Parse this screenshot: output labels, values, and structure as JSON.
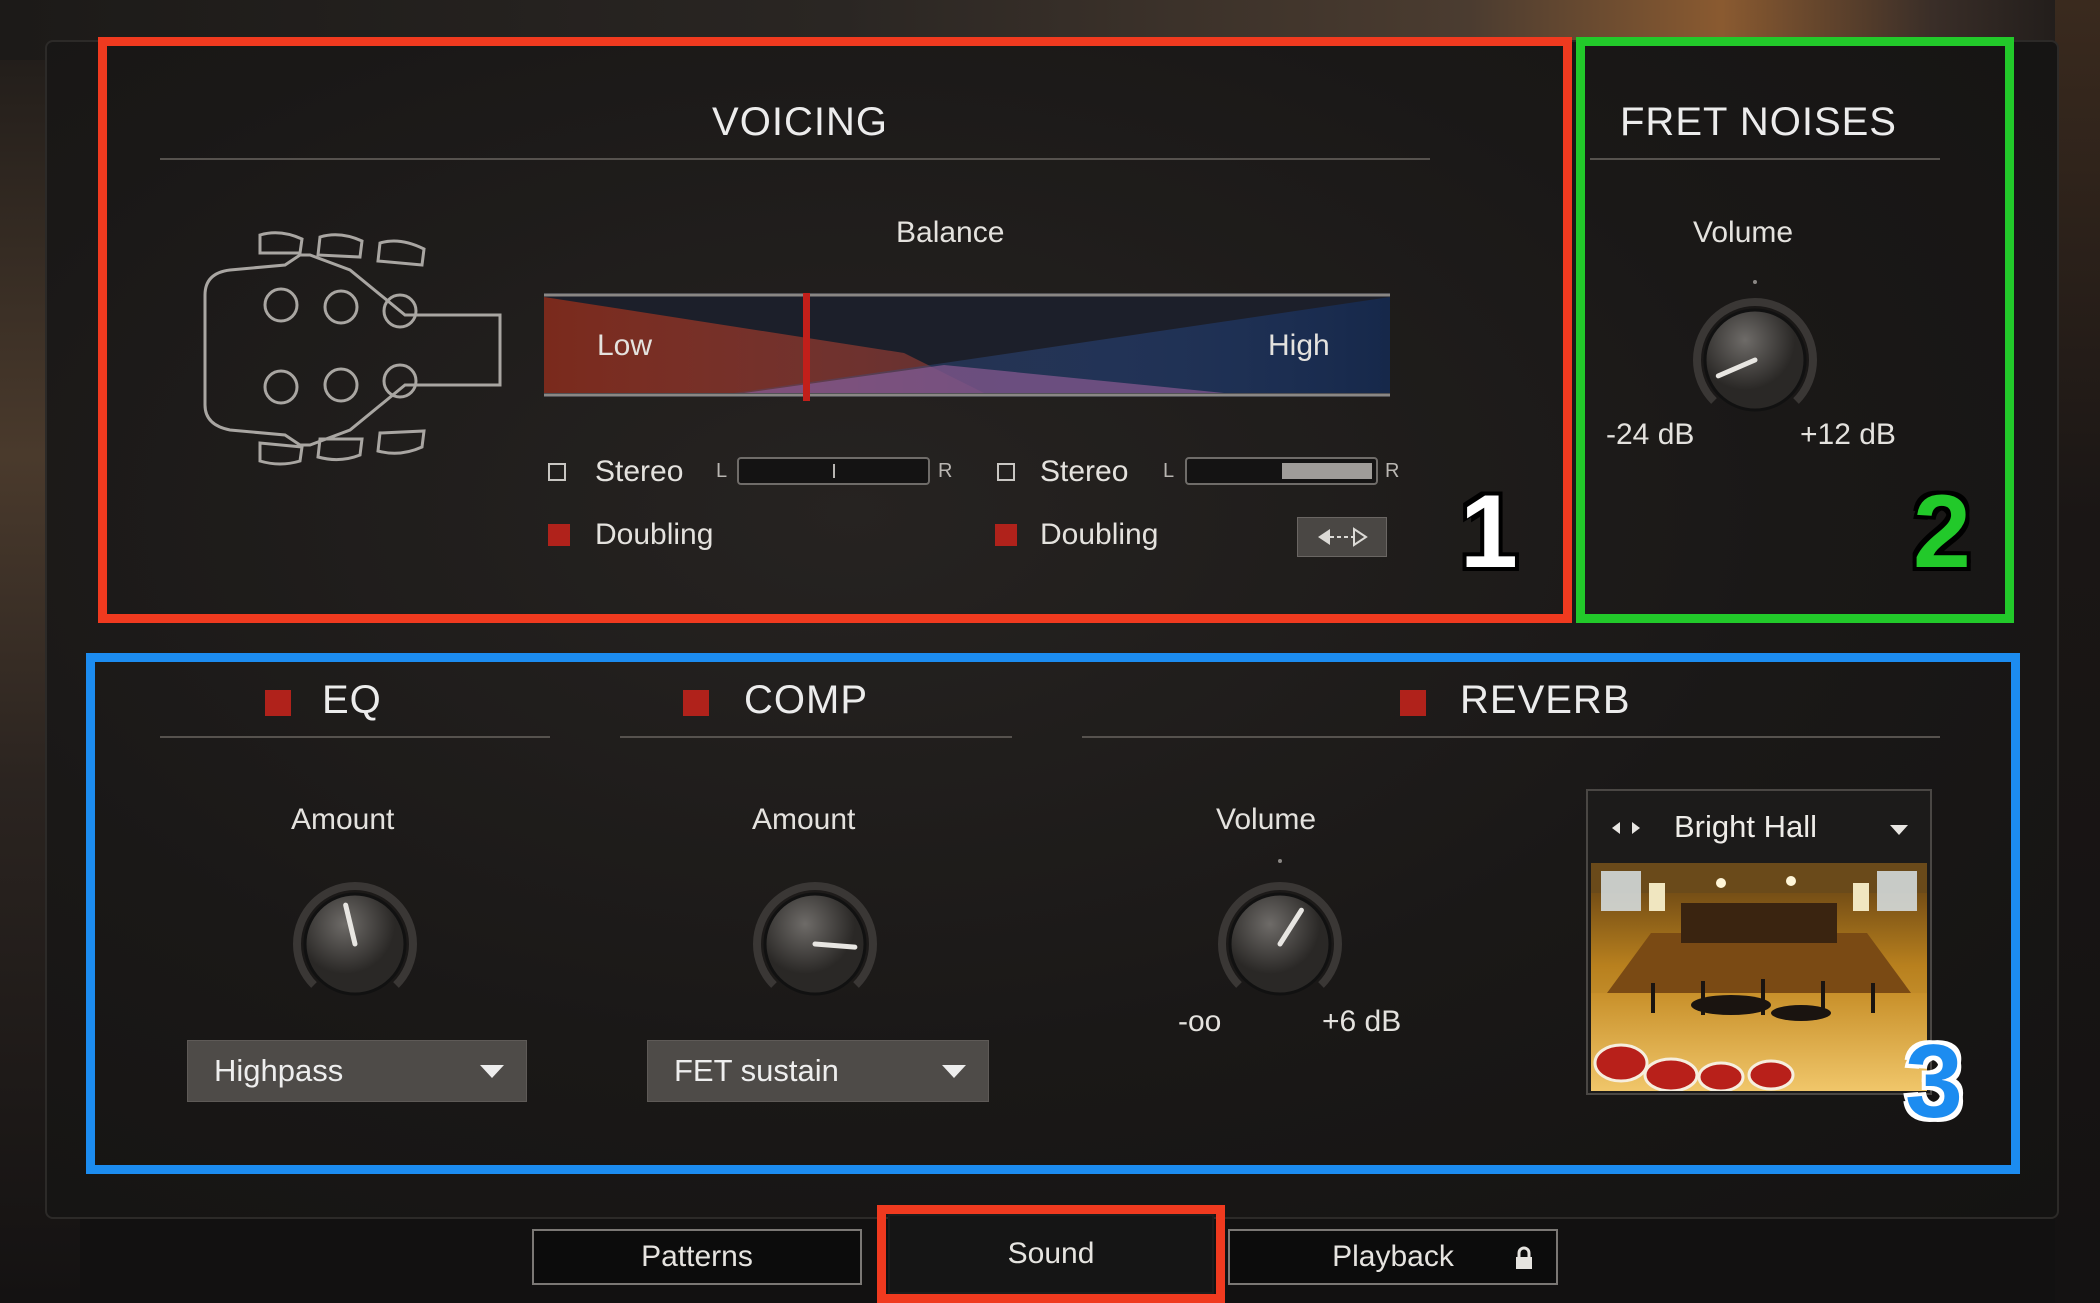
{
  "voicing": {
    "title": "VOICING",
    "balance_label": "Balance",
    "low_label": "Low",
    "high_label": "High",
    "balance_position": 0.31,
    "left": {
      "stereo_label": "Stereo",
      "doubling_label": "Doubling",
      "stereo_checked": false,
      "doubling_on": true,
      "width_value": 0.5
    },
    "right": {
      "stereo_label": "Stereo",
      "doubling_label": "Doubling",
      "stereo_checked": false,
      "doubling_on": true,
      "width_value": 0.55
    },
    "l_marker": "L",
    "r_marker": "R",
    "swap_icon": "swap-arrows-icon",
    "headstock_icon": "guitar-headstock-icon"
  },
  "fret_noises": {
    "title": "FRET NOISES",
    "volume_label": "Volume",
    "min_label": "-24 dB",
    "max_label": "+12 dB",
    "volume_level": 0.08
  },
  "eq": {
    "title": "EQ",
    "enabled": true,
    "amount_label": "Amount",
    "amount_level": 0.45,
    "mode": "Highpass"
  },
  "comp": {
    "title": "COMP",
    "enabled": true,
    "amount_label": "Amount",
    "amount_level": 0.85,
    "mode": "FET sustain"
  },
  "reverb": {
    "title": "REVERB",
    "enabled": true,
    "volume_label": "Volume",
    "min_label": "-oo",
    "max_label": "+6 dB",
    "volume_level": 0.62,
    "preset": "Bright Hall",
    "prev_next_icon": "prev-next-arrows-icon"
  },
  "tabs": [
    {
      "label": "Patterns",
      "active": false
    },
    {
      "label": "Sound",
      "active": true
    },
    {
      "label": "Playback",
      "active": false,
      "icon": "lock-icon"
    }
  ],
  "annotations": {
    "one": "1",
    "two": "2",
    "three": "3"
  },
  "colors": {
    "accent_red": "#b0221b",
    "highlight_red": "#f03a1f",
    "highlight_green": "#22c92a",
    "highlight_blue": "#1c8cf0"
  }
}
